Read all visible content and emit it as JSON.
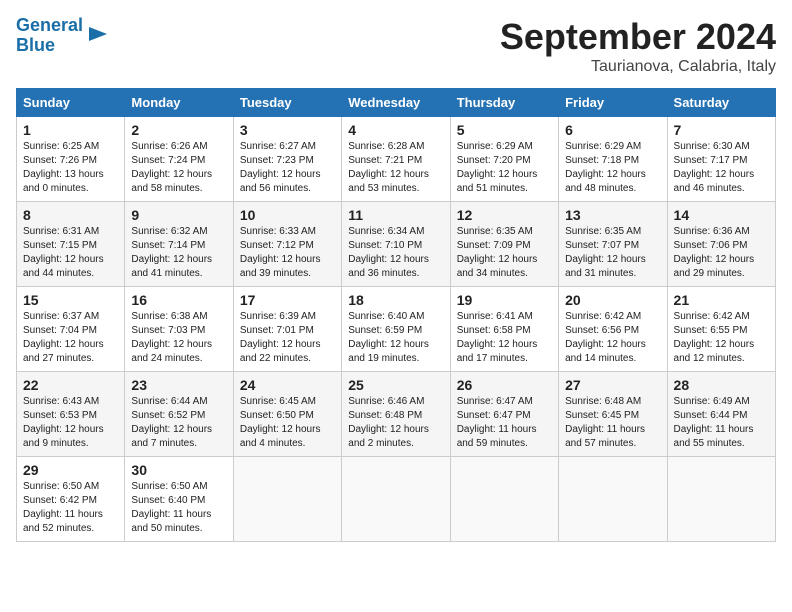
{
  "header": {
    "logo_line1": "General",
    "logo_line2": "Blue",
    "month": "September 2024",
    "location": "Taurianova, Calabria, Italy"
  },
  "days_of_week": [
    "Sunday",
    "Monday",
    "Tuesday",
    "Wednesday",
    "Thursday",
    "Friday",
    "Saturday"
  ],
  "weeks": [
    [
      {
        "day": "1",
        "info": "Sunrise: 6:25 AM\nSunset: 7:26 PM\nDaylight: 13 hours\nand 0 minutes."
      },
      {
        "day": "2",
        "info": "Sunrise: 6:26 AM\nSunset: 7:24 PM\nDaylight: 12 hours\nand 58 minutes."
      },
      {
        "day": "3",
        "info": "Sunrise: 6:27 AM\nSunset: 7:23 PM\nDaylight: 12 hours\nand 56 minutes."
      },
      {
        "day": "4",
        "info": "Sunrise: 6:28 AM\nSunset: 7:21 PM\nDaylight: 12 hours\nand 53 minutes."
      },
      {
        "day": "5",
        "info": "Sunrise: 6:29 AM\nSunset: 7:20 PM\nDaylight: 12 hours\nand 51 minutes."
      },
      {
        "day": "6",
        "info": "Sunrise: 6:29 AM\nSunset: 7:18 PM\nDaylight: 12 hours\nand 48 minutes."
      },
      {
        "day": "7",
        "info": "Sunrise: 6:30 AM\nSunset: 7:17 PM\nDaylight: 12 hours\nand 46 minutes."
      }
    ],
    [
      {
        "day": "8",
        "info": "Sunrise: 6:31 AM\nSunset: 7:15 PM\nDaylight: 12 hours\nand 44 minutes."
      },
      {
        "day": "9",
        "info": "Sunrise: 6:32 AM\nSunset: 7:14 PM\nDaylight: 12 hours\nand 41 minutes."
      },
      {
        "day": "10",
        "info": "Sunrise: 6:33 AM\nSunset: 7:12 PM\nDaylight: 12 hours\nand 39 minutes."
      },
      {
        "day": "11",
        "info": "Sunrise: 6:34 AM\nSunset: 7:10 PM\nDaylight: 12 hours\nand 36 minutes."
      },
      {
        "day": "12",
        "info": "Sunrise: 6:35 AM\nSunset: 7:09 PM\nDaylight: 12 hours\nand 34 minutes."
      },
      {
        "day": "13",
        "info": "Sunrise: 6:35 AM\nSunset: 7:07 PM\nDaylight: 12 hours\nand 31 minutes."
      },
      {
        "day": "14",
        "info": "Sunrise: 6:36 AM\nSunset: 7:06 PM\nDaylight: 12 hours\nand 29 minutes."
      }
    ],
    [
      {
        "day": "15",
        "info": "Sunrise: 6:37 AM\nSunset: 7:04 PM\nDaylight: 12 hours\nand 27 minutes."
      },
      {
        "day": "16",
        "info": "Sunrise: 6:38 AM\nSunset: 7:03 PM\nDaylight: 12 hours\nand 24 minutes."
      },
      {
        "day": "17",
        "info": "Sunrise: 6:39 AM\nSunset: 7:01 PM\nDaylight: 12 hours\nand 22 minutes."
      },
      {
        "day": "18",
        "info": "Sunrise: 6:40 AM\nSunset: 6:59 PM\nDaylight: 12 hours\nand 19 minutes."
      },
      {
        "day": "19",
        "info": "Sunrise: 6:41 AM\nSunset: 6:58 PM\nDaylight: 12 hours\nand 17 minutes."
      },
      {
        "day": "20",
        "info": "Sunrise: 6:42 AM\nSunset: 6:56 PM\nDaylight: 12 hours\nand 14 minutes."
      },
      {
        "day": "21",
        "info": "Sunrise: 6:42 AM\nSunset: 6:55 PM\nDaylight: 12 hours\nand 12 minutes."
      }
    ],
    [
      {
        "day": "22",
        "info": "Sunrise: 6:43 AM\nSunset: 6:53 PM\nDaylight: 12 hours\nand 9 minutes."
      },
      {
        "day": "23",
        "info": "Sunrise: 6:44 AM\nSunset: 6:52 PM\nDaylight: 12 hours\nand 7 minutes."
      },
      {
        "day": "24",
        "info": "Sunrise: 6:45 AM\nSunset: 6:50 PM\nDaylight: 12 hours\nand 4 minutes."
      },
      {
        "day": "25",
        "info": "Sunrise: 6:46 AM\nSunset: 6:48 PM\nDaylight: 12 hours\nand 2 minutes."
      },
      {
        "day": "26",
        "info": "Sunrise: 6:47 AM\nSunset: 6:47 PM\nDaylight: 11 hours\nand 59 minutes."
      },
      {
        "day": "27",
        "info": "Sunrise: 6:48 AM\nSunset: 6:45 PM\nDaylight: 11 hours\nand 57 minutes."
      },
      {
        "day": "28",
        "info": "Sunrise: 6:49 AM\nSunset: 6:44 PM\nDaylight: 11 hours\nand 55 minutes."
      }
    ],
    [
      {
        "day": "29",
        "info": "Sunrise: 6:50 AM\nSunset: 6:42 PM\nDaylight: 11 hours\nand 52 minutes."
      },
      {
        "day": "30",
        "info": "Sunrise: 6:50 AM\nSunset: 6:40 PM\nDaylight: 11 hours\nand 50 minutes."
      },
      {
        "day": "",
        "info": ""
      },
      {
        "day": "",
        "info": ""
      },
      {
        "day": "",
        "info": ""
      },
      {
        "day": "",
        "info": ""
      },
      {
        "day": "",
        "info": ""
      }
    ]
  ]
}
